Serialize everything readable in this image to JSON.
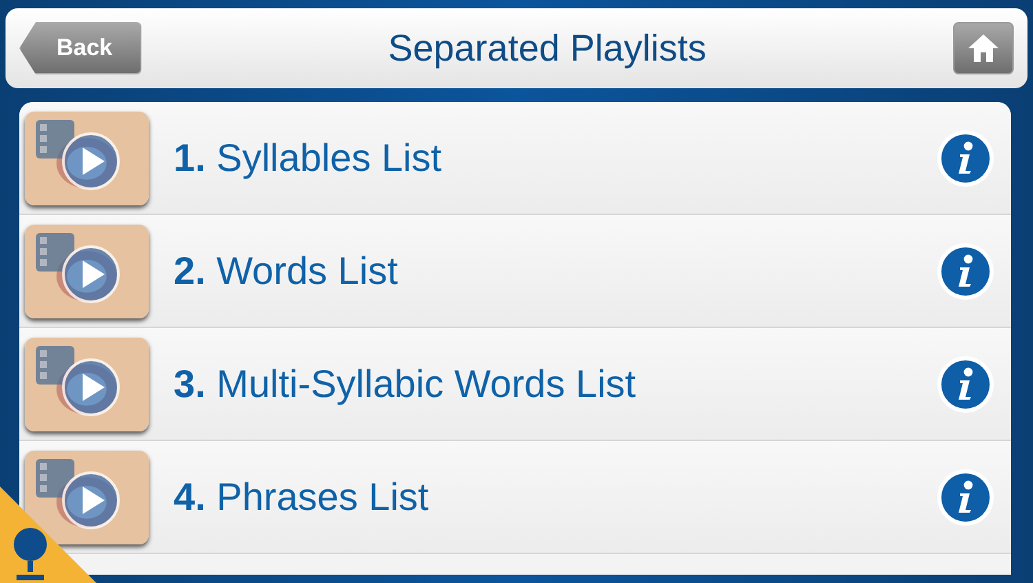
{
  "header": {
    "back_label": "Back",
    "title": "Separated Playlists"
  },
  "playlists": [
    {
      "title": "**1.** Syllables List"
    },
    {
      "title": "**2.** Words List"
    },
    {
      "title": "**3.** Multi-Syllabic Words List"
    },
    {
      "title": "**4.** Phrases List"
    }
  ]
}
